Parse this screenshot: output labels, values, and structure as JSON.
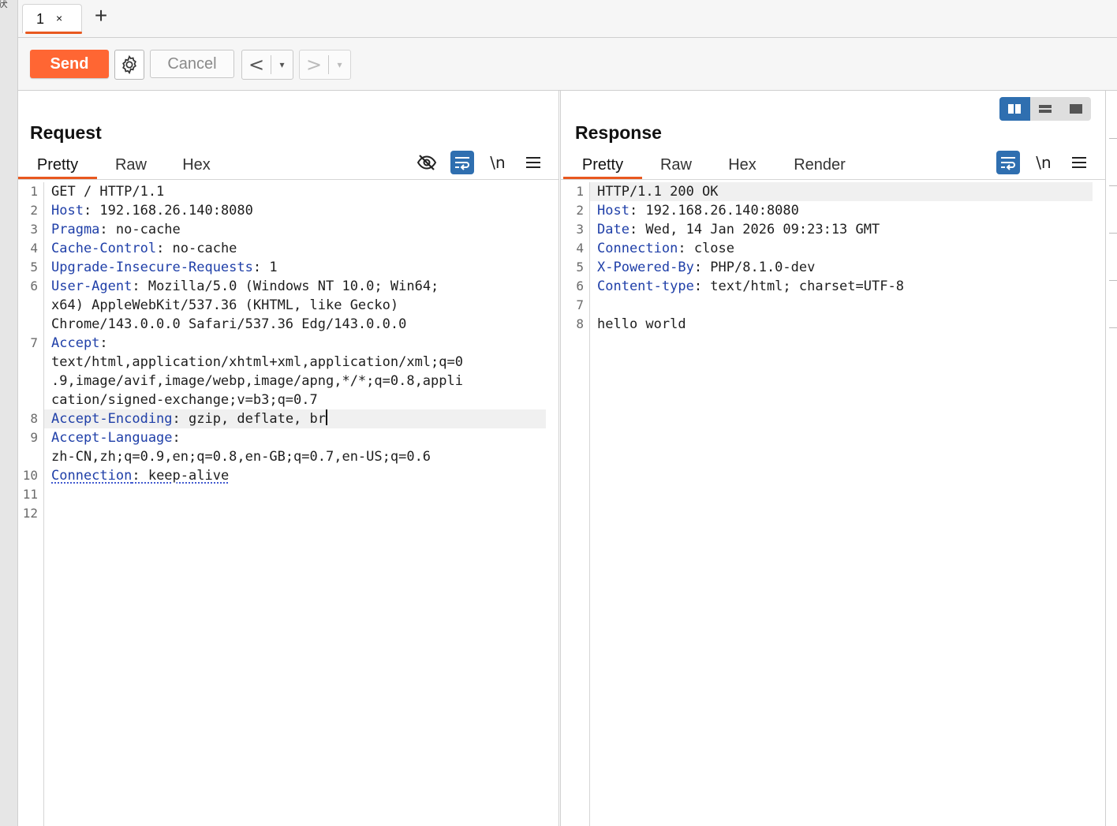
{
  "gutter": {
    "glyph": "获"
  },
  "tabs": [
    {
      "label": "1",
      "close": "×"
    }
  ],
  "add_tab": "+",
  "toolbar": {
    "send_label": "Send",
    "cancel_label": "Cancel",
    "back": "<",
    "forward": ">",
    "dropdown": "▾"
  },
  "request": {
    "title": "Request",
    "tabs": [
      "Pretty",
      "Raw",
      "Hex"
    ],
    "active_tab": "Pretty",
    "newline_toggle": "\\n",
    "lines": [
      {
        "no": "1",
        "key": "",
        "val": "GET / HTTP/1.1"
      },
      {
        "no": "2",
        "key": "Host",
        "val": ": 192.168.26.140:8080"
      },
      {
        "no": "3",
        "key": "Pragma",
        "val": ": no-cache"
      },
      {
        "no": "4",
        "key": "Cache-Control",
        "val": ": no-cache"
      },
      {
        "no": "5",
        "key": "Upgrade-Insecure-Requests",
        "val": ": 1"
      },
      {
        "no": "6",
        "key": "User-Agent",
        "val": ": Mozilla/5.0 (Windows NT 10.0; Win64;"
      },
      {
        "no": "",
        "key": "",
        "val": "x64) AppleWebKit/537.36 (KHTML, like Gecko)"
      },
      {
        "no": "",
        "key": "",
        "val": "Chrome/143.0.0.0 Safari/537.36 Edg/143.0.0.0"
      },
      {
        "no": "7",
        "key": "Accept",
        "val": ":"
      },
      {
        "no": "",
        "key": "",
        "val": "text/html,application/xhtml+xml,application/xml;q=0"
      },
      {
        "no": "",
        "key": "",
        "val": ".9,image/avif,image/webp,image/apng,*/*;q=0.8,appli"
      },
      {
        "no": "",
        "key": "",
        "val": "cation/signed-exchange;v=b3;q=0.7"
      },
      {
        "no": "8",
        "key": "Accept-Encoding",
        "val": ": gzip, deflate, br"
      },
      {
        "no": "9",
        "key": "Accept-Language",
        "val": ":"
      },
      {
        "no": "",
        "key": "",
        "val": "zh-CN,zh;q=0.9,en;q=0.8,en-GB;q=0.7,en-US;q=0.6"
      },
      {
        "no": "10",
        "key": "Connection",
        "val": ": keep-alive"
      },
      {
        "no": "11",
        "key": "",
        "val": ""
      },
      {
        "no": "12",
        "key": "",
        "val": ""
      }
    ]
  },
  "response": {
    "title": "Response",
    "tabs": [
      "Pretty",
      "Raw",
      "Hex",
      "Render"
    ],
    "active_tab": "Pretty",
    "newline_toggle": "\\n",
    "lines": [
      {
        "no": "1",
        "key": "",
        "val": "HTTP/1.1 200 OK"
      },
      {
        "no": "2",
        "key": "Host",
        "val": ": 192.168.26.140:8080"
      },
      {
        "no": "3",
        "key": "Date",
        "val": ": Wed, 14 Jan 2026 09:23:13 GMT"
      },
      {
        "no": "4",
        "key": "Connection",
        "val": ": close"
      },
      {
        "no": "5",
        "key": "X-Powered-By",
        "val": ": PHP/8.1.0-dev"
      },
      {
        "no": "6",
        "key": "Content-type",
        "val": ": text/html; charset=UTF-8"
      },
      {
        "no": "7",
        "key": "",
        "val": ""
      },
      {
        "no": "8",
        "key": "",
        "val": "hello world"
      }
    ]
  },
  "colors": {
    "accent": "#ff6633",
    "header_key": "#1f3fa8",
    "toggle_active": "#2f6fb0"
  }
}
